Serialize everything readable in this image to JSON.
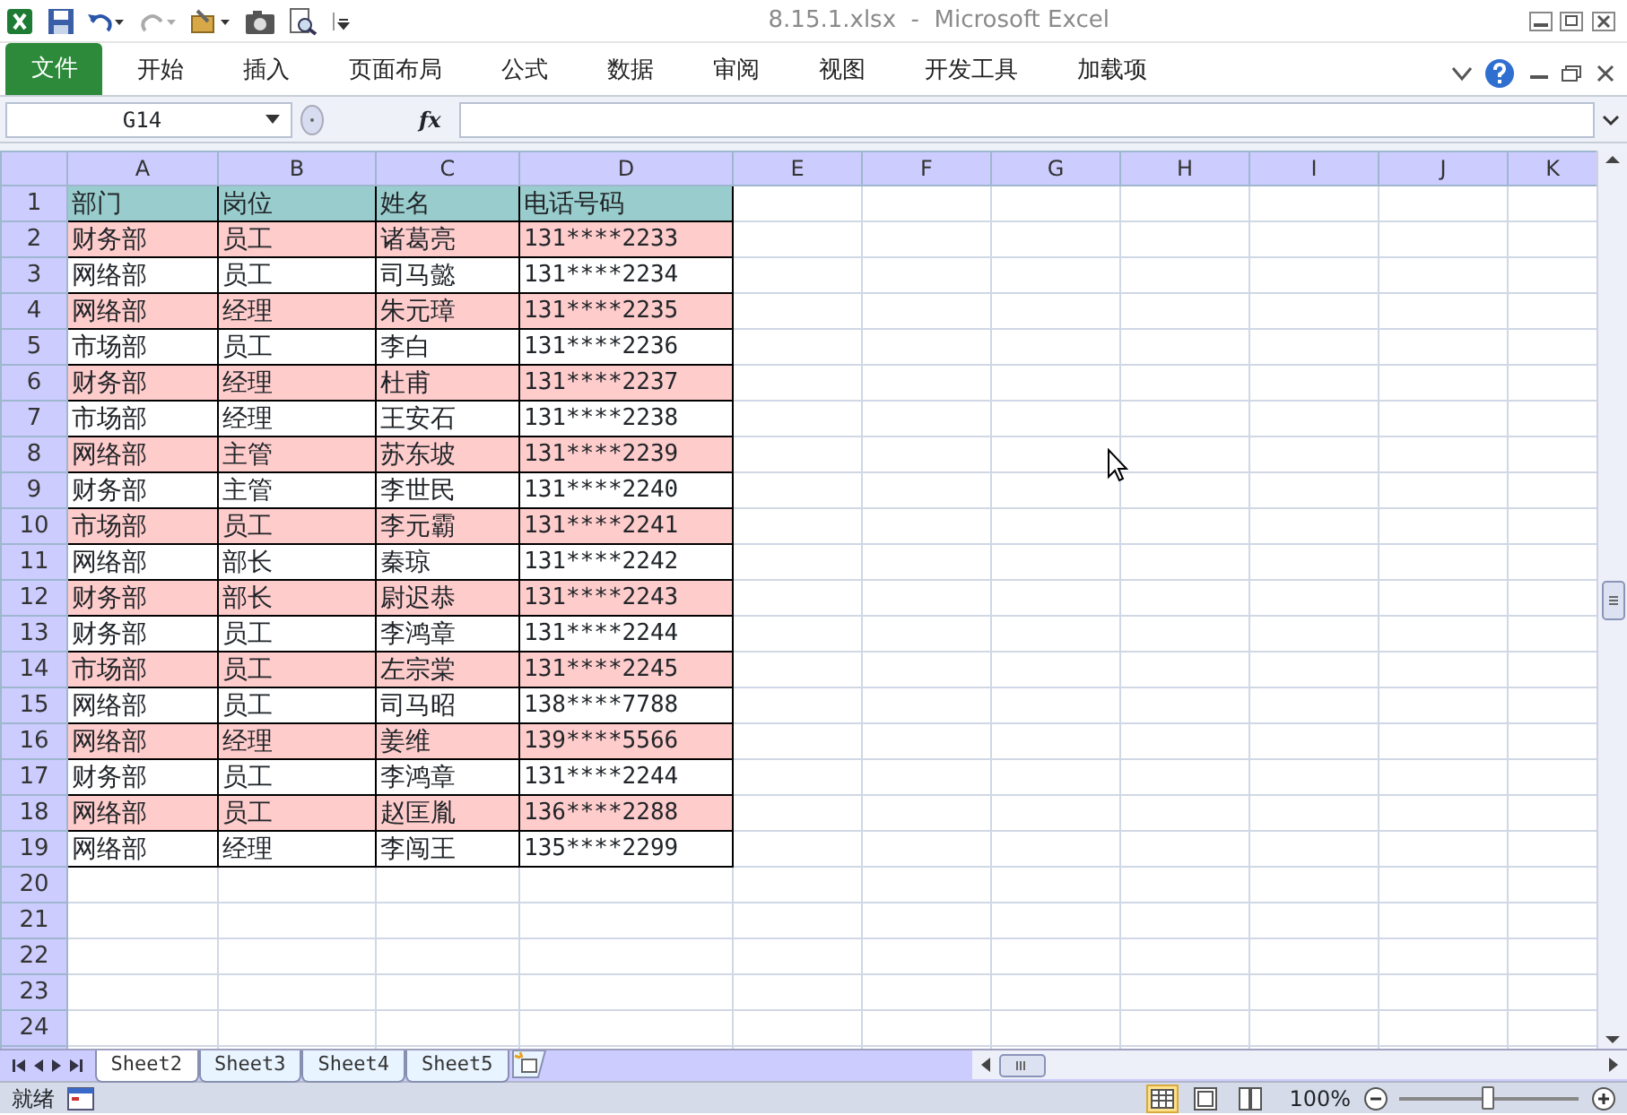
{
  "window": {
    "title": "8.15.1.xlsx  -  Microsoft Excel"
  },
  "ribbon_tabs": [
    {
      "label": "文件",
      "kind": "file"
    },
    {
      "label": "开始",
      "kind": "tab"
    },
    {
      "label": "插入",
      "kind": "tab"
    },
    {
      "label": "页面布局",
      "kind": "tab"
    },
    {
      "label": "公式",
      "kind": "tab"
    },
    {
      "label": "数据",
      "kind": "tab"
    },
    {
      "label": "审阅",
      "kind": "tab"
    },
    {
      "label": "视图",
      "kind": "tab"
    },
    {
      "label": "开发工具",
      "kind": "tab"
    },
    {
      "label": "加载项",
      "kind": "tab"
    }
  ],
  "formula_bar": {
    "name_box": "G14",
    "function_label": "fx"
  },
  "columns": [
    "A",
    "B",
    "C",
    "D",
    "E",
    "F",
    "G",
    "H",
    "I",
    "J",
    "K"
  ],
  "rows": [
    {
      "number": "1",
      "kind": "header",
      "cells": [
        "部门",
        "岗位",
        "姓名",
        "电话号码"
      ]
    },
    {
      "number": "2",
      "kind": "data",
      "highlighted": true,
      "cells": [
        "财务部",
        "员工",
        "诸葛亮",
        "131****2233"
      ]
    },
    {
      "number": "3",
      "kind": "data",
      "highlighted": false,
      "cells": [
        "网络部",
        "员工",
        "司马懿",
        "131****2234"
      ]
    },
    {
      "number": "4",
      "kind": "data",
      "highlighted": true,
      "cells": [
        "网络部",
        "经理",
        "朱元璋",
        "131****2235"
      ]
    },
    {
      "number": "5",
      "kind": "data",
      "highlighted": false,
      "cells": [
        "市场部",
        "员工",
        "李白",
        "131****2236"
      ]
    },
    {
      "number": "6",
      "kind": "data",
      "highlighted": true,
      "cells": [
        "财务部",
        "经理",
        "杜甫",
        "131****2237"
      ]
    },
    {
      "number": "7",
      "kind": "data",
      "highlighted": false,
      "cells": [
        "市场部",
        "经理",
        "王安石",
        "131****2238"
      ]
    },
    {
      "number": "8",
      "kind": "data",
      "highlighted": true,
      "cells": [
        "网络部",
        "主管",
        "苏东坡",
        "131****2239"
      ]
    },
    {
      "number": "9",
      "kind": "data",
      "highlighted": false,
      "cells": [
        "财务部",
        "主管",
        "李世民",
        "131****2240"
      ]
    },
    {
      "number": "10",
      "kind": "data",
      "highlighted": true,
      "cells": [
        "市场部",
        "员工",
        "李元霸",
        "131****2241"
      ]
    },
    {
      "number": "11",
      "kind": "data",
      "highlighted": false,
      "cells": [
        "网络部",
        "部长",
        "秦琼",
        "131****2242"
      ]
    },
    {
      "number": "12",
      "kind": "data",
      "highlighted": true,
      "cells": [
        "财务部",
        "部长",
        "尉迟恭",
        "131****2243"
      ]
    },
    {
      "number": "13",
      "kind": "data",
      "highlighted": false,
      "cells": [
        "财务部",
        "员工",
        "李鸿章",
        "131****2244"
      ]
    },
    {
      "number": "14",
      "kind": "data",
      "highlighted": true,
      "cells": [
        "市场部",
        "员工",
        "左宗棠",
        "131****2245"
      ]
    },
    {
      "number": "15",
      "kind": "data",
      "highlighted": false,
      "cells": [
        "网络部",
        "员工",
        "司马昭",
        "138****7788"
      ]
    },
    {
      "number": "16",
      "kind": "data",
      "highlighted": true,
      "cells": [
        "网络部",
        "经理",
        "姜维",
        "139****5566"
      ]
    },
    {
      "number": "17",
      "kind": "data",
      "highlighted": false,
      "cells": [
        "财务部",
        "员工",
        "李鸿章",
        "131****2244"
      ]
    },
    {
      "number": "18",
      "kind": "data",
      "highlighted": true,
      "cells": [
        "网络部",
        "员工",
        "赵匡胤",
        "136****2288"
      ]
    },
    {
      "number": "19",
      "kind": "data",
      "highlighted": false,
      "cells": [
        "网络部",
        "经理",
        "李闯王",
        "135****2299"
      ]
    },
    {
      "number": "20"
    },
    {
      "number": "21"
    },
    {
      "number": "22"
    },
    {
      "number": "23"
    },
    {
      "number": "24"
    }
  ],
  "sheet_tabs": [
    {
      "label": "Sheet2",
      "selected": true
    },
    {
      "label": "Sheet3",
      "selected": false
    },
    {
      "label": "Sheet4",
      "selected": false
    },
    {
      "label": "Sheet5",
      "selected": false
    }
  ],
  "status_bar": {
    "status": "就绪",
    "views": [
      {
        "kind": "normal",
        "selected": true
      },
      {
        "kind": "page-layout",
        "selected": false
      },
      {
        "kind": "page-break",
        "selected": false
      }
    ],
    "zoom": "100%",
    "zoom_slider": {
      "level": 0.5
    }
  }
}
